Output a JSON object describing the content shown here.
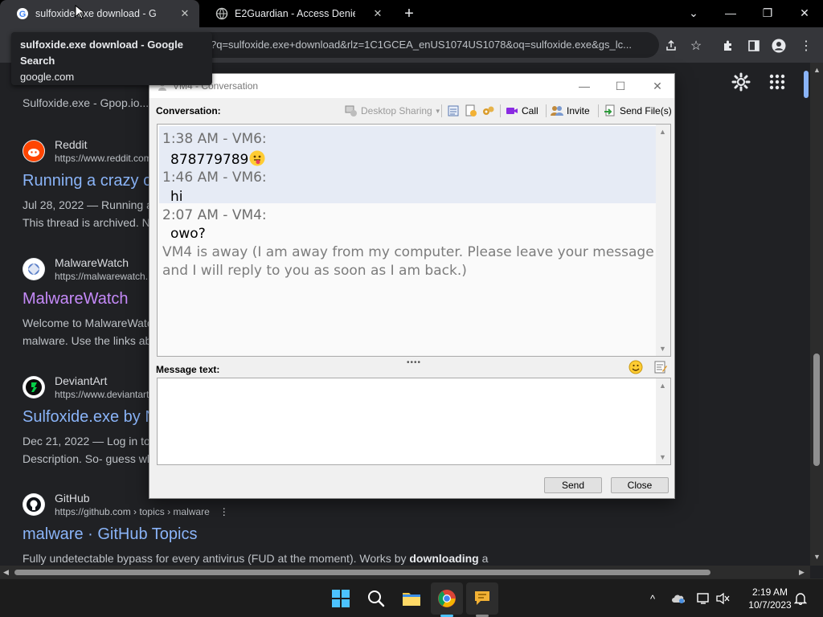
{
  "browser": {
    "tabs": [
      {
        "title": "sulfoxide.exe download - Google"
      },
      {
        "title": "E2Guardian - Access Denied"
      }
    ],
    "omnibox_text": "?q=sulfoxide.exe+download&rlz=1C1GCEA_enUS1074US1078&oq=sulfoxide.exe&gs_lc...",
    "tooltip": {
      "title": "sulfoxide.exe download - Google Search",
      "domain": "google.com"
    }
  },
  "results": {
    "partial_top": "Sulfoxide.exe - Gpop.io...",
    "items": [
      {
        "site": "Reddit",
        "url": "https://www.reddit.com",
        "title": "Running a crazy c",
        "desc1": "Jul 28, 2022 — Running a",
        "desc2": "This thread is archived. N",
        "visited": false
      },
      {
        "site": "MalwareWatch",
        "url": "https://malwarewatch.",
        "title": "MalwareWatch",
        "desc1": "Welcome to MalwareWatc",
        "desc2": "malware. Use the links ab",
        "visited": true
      },
      {
        "site": "DeviantArt",
        "url": "https://www.deviantart",
        "title": "Sulfoxide.exe by N",
        "desc1": "Dec 21, 2022 — Log in to",
        "desc2": "Description. So- guess wh",
        "visited": false
      },
      {
        "site": "GitHub",
        "url": "https://github.com › topics › malware",
        "title": "malware · GitHub Topics",
        "desc1": "Fully undetectable bypass for every antivirus (FUD at the moment). Works by downloading a",
        "visited": false
      }
    ]
  },
  "dialog": {
    "title": "VM4 - Conversation",
    "conversation_label": "Conversation:",
    "toolbar": {
      "desktop_sharing": "Desktop Sharing",
      "call": "Call",
      "invite": "Invite",
      "send_files": "Send File(s)"
    },
    "messages": [
      {
        "header": "1:38 AM - VM6:",
        "text": "878779789"
      },
      {
        "header": "1:46 AM - VM6:",
        "text": "hi"
      },
      {
        "header": "2:07 AM - VM4:",
        "text": "owo?"
      }
    ],
    "away_notice": "VM4 is away (I am away from my computer. Please leave your message and I will reply to you as soon as I am back.)",
    "message_text_label": "Message text:",
    "message_value": "",
    "send_label": "Send",
    "close_label": "Close"
  },
  "taskbar": {
    "time": "2:19 AM",
    "date": "10/7/2023"
  },
  "colors": {
    "link_blue": "#8ab4f8",
    "link_visited": "#c58af9",
    "chrome_bg": "#202124",
    "dialog_bg": "#f0f0f0"
  }
}
